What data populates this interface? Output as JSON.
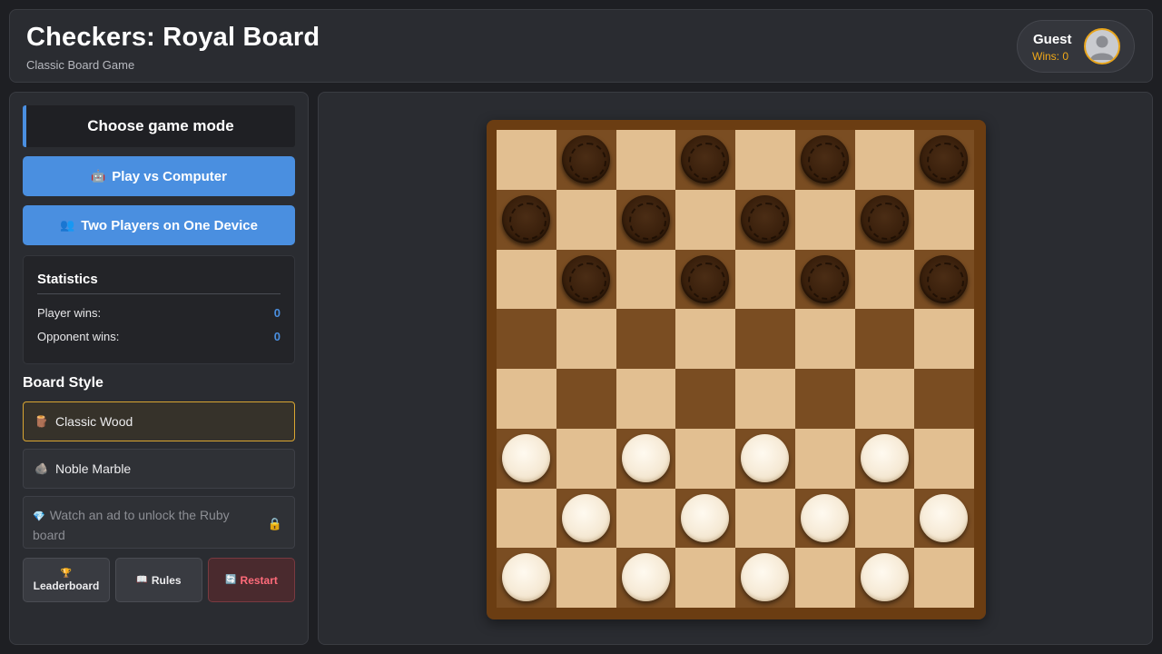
{
  "header": {
    "title": "Checkers: Royal Board",
    "subtitle": "Classic Board Game",
    "user": {
      "name": "Guest",
      "wins": "Wins: 0"
    }
  },
  "sidebar": {
    "mode_heading": "Choose game mode",
    "buttons": {
      "vs_computer": {
        "icon": "🤖",
        "label": "Play vs Computer"
      },
      "two_players": {
        "icon": "👥",
        "label": "Two Players on One Device"
      }
    },
    "statistics": {
      "title": "Statistics",
      "player_wins_label": "Player wins:",
      "player_wins_value": "0",
      "opponent_wins_label": "Opponent wins:",
      "opponent_wins_value": "0"
    },
    "board_style": {
      "title": "Board Style",
      "options": [
        {
          "icon": "🪵",
          "label": "Classic Wood",
          "selected": true
        },
        {
          "icon": "🪨",
          "label": "Noble Marble",
          "selected": false
        }
      ],
      "locked": {
        "icon": "💎",
        "label": "Watch an ad to unlock the Ruby board",
        "lock_icon": "🔒"
      }
    },
    "actions": {
      "leaderboard": {
        "icon": "🏆",
        "label": "Leaderboard"
      },
      "rules": {
        "icon": "📖",
        "label": "Rules"
      },
      "restart": {
        "icon": "🔄",
        "label": "Restart"
      }
    }
  },
  "board": {
    "size": 8,
    "style": "Classic Wood",
    "colors": {
      "light": "#e2bf91",
      "dark": "#7a4d22",
      "frame": "#6b3d12"
    },
    "rows": [
      ".b.b.b.b",
      "b.b.b.b.",
      ".b.b.b.b",
      "........",
      "........",
      "w.w.w.w.",
      ".w.w.w.w",
      "w.w.w.w."
    ]
  }
}
